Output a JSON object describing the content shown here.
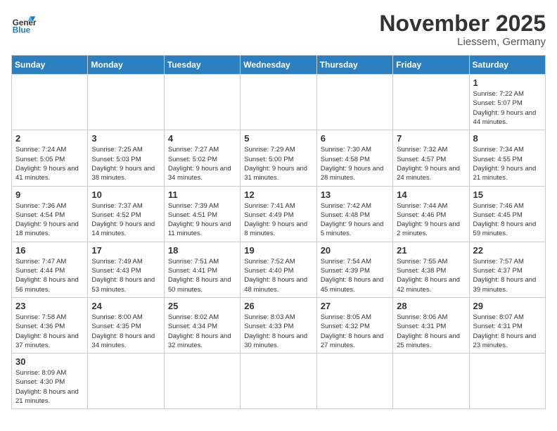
{
  "header": {
    "logo_general": "General",
    "logo_blue": "Blue",
    "month_title": "November 2025",
    "location": "Liessem, Germany"
  },
  "calendar": {
    "days_of_week": [
      "Sunday",
      "Monday",
      "Tuesday",
      "Wednesday",
      "Thursday",
      "Friday",
      "Saturday"
    ],
    "weeks": [
      [
        {
          "day": "",
          "info": ""
        },
        {
          "day": "",
          "info": ""
        },
        {
          "day": "",
          "info": ""
        },
        {
          "day": "",
          "info": ""
        },
        {
          "day": "",
          "info": ""
        },
        {
          "day": "",
          "info": ""
        },
        {
          "day": "1",
          "info": "Sunrise: 7:22 AM\nSunset: 5:07 PM\nDaylight: 9 hours and 44 minutes."
        }
      ],
      [
        {
          "day": "2",
          "info": "Sunrise: 7:24 AM\nSunset: 5:05 PM\nDaylight: 9 hours and 41 minutes."
        },
        {
          "day": "3",
          "info": "Sunrise: 7:25 AM\nSunset: 5:03 PM\nDaylight: 9 hours and 38 minutes."
        },
        {
          "day": "4",
          "info": "Sunrise: 7:27 AM\nSunset: 5:02 PM\nDaylight: 9 hours and 34 minutes."
        },
        {
          "day": "5",
          "info": "Sunrise: 7:29 AM\nSunset: 5:00 PM\nDaylight: 9 hours and 31 minutes."
        },
        {
          "day": "6",
          "info": "Sunrise: 7:30 AM\nSunset: 4:58 PM\nDaylight: 9 hours and 28 minutes."
        },
        {
          "day": "7",
          "info": "Sunrise: 7:32 AM\nSunset: 4:57 PM\nDaylight: 9 hours and 24 minutes."
        },
        {
          "day": "8",
          "info": "Sunrise: 7:34 AM\nSunset: 4:55 PM\nDaylight: 9 hours and 21 minutes."
        }
      ],
      [
        {
          "day": "9",
          "info": "Sunrise: 7:36 AM\nSunset: 4:54 PM\nDaylight: 9 hours and 18 minutes."
        },
        {
          "day": "10",
          "info": "Sunrise: 7:37 AM\nSunset: 4:52 PM\nDaylight: 9 hours and 14 minutes."
        },
        {
          "day": "11",
          "info": "Sunrise: 7:39 AM\nSunset: 4:51 PM\nDaylight: 9 hours and 11 minutes."
        },
        {
          "day": "12",
          "info": "Sunrise: 7:41 AM\nSunset: 4:49 PM\nDaylight: 9 hours and 8 minutes."
        },
        {
          "day": "13",
          "info": "Sunrise: 7:42 AM\nSunset: 4:48 PM\nDaylight: 9 hours and 5 minutes."
        },
        {
          "day": "14",
          "info": "Sunrise: 7:44 AM\nSunset: 4:46 PM\nDaylight: 9 hours and 2 minutes."
        },
        {
          "day": "15",
          "info": "Sunrise: 7:46 AM\nSunset: 4:45 PM\nDaylight: 8 hours and 59 minutes."
        }
      ],
      [
        {
          "day": "16",
          "info": "Sunrise: 7:47 AM\nSunset: 4:44 PM\nDaylight: 8 hours and 56 minutes."
        },
        {
          "day": "17",
          "info": "Sunrise: 7:49 AM\nSunset: 4:43 PM\nDaylight: 8 hours and 53 minutes."
        },
        {
          "day": "18",
          "info": "Sunrise: 7:51 AM\nSunset: 4:41 PM\nDaylight: 8 hours and 50 minutes."
        },
        {
          "day": "19",
          "info": "Sunrise: 7:52 AM\nSunset: 4:40 PM\nDaylight: 8 hours and 48 minutes."
        },
        {
          "day": "20",
          "info": "Sunrise: 7:54 AM\nSunset: 4:39 PM\nDaylight: 8 hours and 45 minutes."
        },
        {
          "day": "21",
          "info": "Sunrise: 7:55 AM\nSunset: 4:38 PM\nDaylight: 8 hours and 42 minutes."
        },
        {
          "day": "22",
          "info": "Sunrise: 7:57 AM\nSunset: 4:37 PM\nDaylight: 8 hours and 39 minutes."
        }
      ],
      [
        {
          "day": "23",
          "info": "Sunrise: 7:58 AM\nSunset: 4:36 PM\nDaylight: 8 hours and 37 minutes."
        },
        {
          "day": "24",
          "info": "Sunrise: 8:00 AM\nSunset: 4:35 PM\nDaylight: 8 hours and 34 minutes."
        },
        {
          "day": "25",
          "info": "Sunrise: 8:02 AM\nSunset: 4:34 PM\nDaylight: 8 hours and 32 minutes."
        },
        {
          "day": "26",
          "info": "Sunrise: 8:03 AM\nSunset: 4:33 PM\nDaylight: 8 hours and 30 minutes."
        },
        {
          "day": "27",
          "info": "Sunrise: 8:05 AM\nSunset: 4:32 PM\nDaylight: 8 hours and 27 minutes."
        },
        {
          "day": "28",
          "info": "Sunrise: 8:06 AM\nSunset: 4:31 PM\nDaylight: 8 hours and 25 minutes."
        },
        {
          "day": "29",
          "info": "Sunrise: 8:07 AM\nSunset: 4:31 PM\nDaylight: 8 hours and 23 minutes."
        }
      ],
      [
        {
          "day": "30",
          "info": "Sunrise: 8:09 AM\nSunset: 4:30 PM\nDaylight: 8 hours and 21 minutes."
        },
        {
          "day": "",
          "info": ""
        },
        {
          "day": "",
          "info": ""
        },
        {
          "day": "",
          "info": ""
        },
        {
          "day": "",
          "info": ""
        },
        {
          "day": "",
          "info": ""
        },
        {
          "day": "",
          "info": ""
        }
      ]
    ]
  }
}
